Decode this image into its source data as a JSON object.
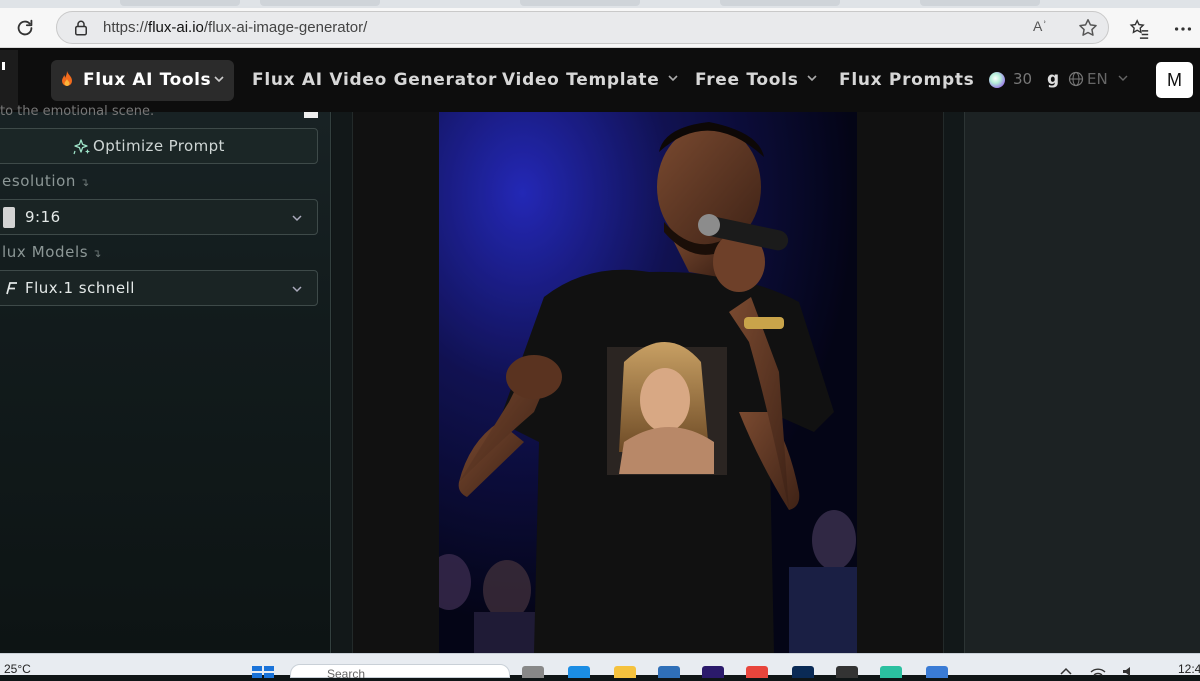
{
  "browser": {
    "url_prefix": "https://",
    "url_domain": "flux-ai.io",
    "url_path": "/flux-ai-image-generator/",
    "read_aloud_label": "Aʾ"
  },
  "nav": {
    "active_menu": "Flux AI Tools",
    "links": [
      "Flux AI Video Generator",
      "Video Template",
      "Free Tools",
      "Flux Prompts"
    ],
    "credits": "30",
    "credits_suffix": "g",
    "language": "EN",
    "avatar_initial": "M"
  },
  "form": {
    "prompt_cut_text": "to the emotional scene.",
    "optimize_label": "Optimize Prompt",
    "resolution_label": "esolution",
    "resolution_arrow": "↴",
    "resolution_value": "9:16",
    "models_label": "lux Models",
    "models_arrow": "↴",
    "model_value": "Flux.1 schnell"
  },
  "image": {
    "subject": "man singing into microphone wearing black t-shirt with portrait print"
  },
  "taskbar": {
    "weather": "25°C",
    "search_label": "Search",
    "clock": "12:4"
  },
  "colors": {
    "page_bg": "#0f1516",
    "nav_bg": "#0d0d0d",
    "panel_bg": "#182224",
    "stage_light": "#2a2fd6"
  }
}
